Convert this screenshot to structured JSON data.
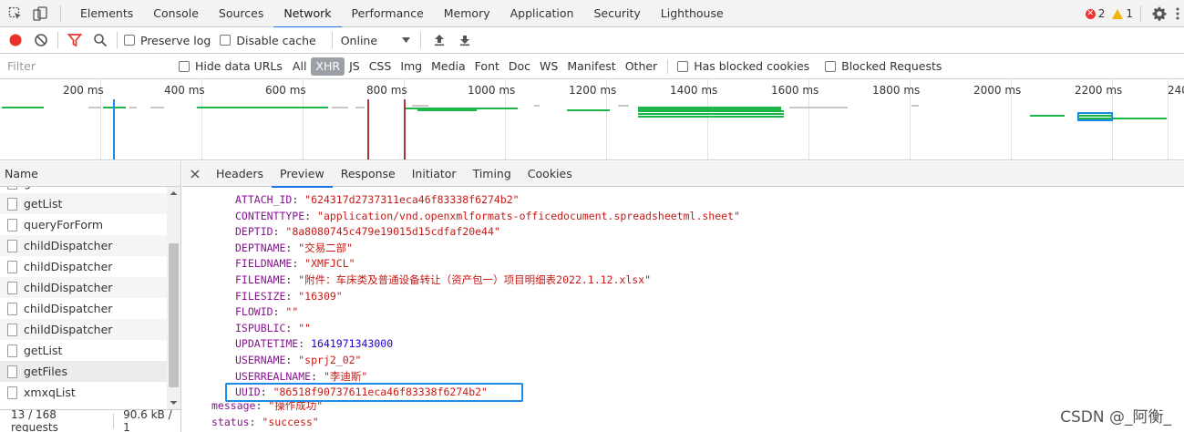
{
  "topbar": {
    "tabs": [
      "Elements",
      "Console",
      "Sources",
      "Network",
      "Performance",
      "Memory",
      "Application",
      "Security",
      "Lighthouse"
    ],
    "active_tab": "Network",
    "errors": "2",
    "warnings": "1",
    "icons": [
      "inspect-icon",
      "device-toggle-icon",
      "more-vertical-icon",
      "gear-icon"
    ]
  },
  "toolbar": {
    "preserve_log": "Preserve log",
    "disable_cache": "Disable cache",
    "throttle": "Online",
    "record_color": "#e8322b",
    "filter_color": "#e8322b"
  },
  "filterbar": {
    "filter_placeholder": "Filter",
    "hide_data_urls": "Hide data URLs",
    "types": [
      "All",
      "XHR",
      "JS",
      "CSS",
      "Img",
      "Media",
      "Font",
      "Doc",
      "WS",
      "Manifest",
      "Other"
    ],
    "selected_type": "XHR",
    "has_blocked": "Has blocked cookies",
    "blocked_requests": "Blocked Requests"
  },
  "timeline": {
    "ticks": [
      "200 ms",
      "400 ms",
      "600 ms",
      "800 ms",
      "1000 ms",
      "1200 ms",
      "1400 ms",
      "1600 ms",
      "1800 ms",
      "2000 ms",
      "2200 ms",
      "240"
    ]
  },
  "requests": {
    "header": "Name",
    "items": [
      "getList",
      "getList",
      "queryForForm",
      "childDispatcher",
      "childDispatcher",
      "childDispatcher",
      "childDispatcher",
      "childDispatcher",
      "getList",
      "getFiles",
      "xmxqList"
    ],
    "selected": "getFiles"
  },
  "status": {
    "requests": "13 / 168 requests",
    "transferred": "90.6 kB / 1"
  },
  "panel": {
    "tabs": [
      "Headers",
      "Preview",
      "Response",
      "Initiator",
      "Timing",
      "Cookies"
    ],
    "active_tab": "Preview"
  },
  "preview": {
    "fields": [
      {
        "key": "ATTACH_ID",
        "value": "\"624317d2737311eca46f83338f6274b2\"",
        "kind": "s"
      },
      {
        "key": "CONTENTTYPE",
        "value": "\"application/vnd.openxmlformats-officedocument.spreadsheetml.sheet\"",
        "kind": "s"
      },
      {
        "key": "DEPTID",
        "value": "\"8a8080745c479e19015d15cdfaf20e44\"",
        "kind": "s"
      },
      {
        "key": "DEPTNAME",
        "value": "\"交易二部\"",
        "kind": "s"
      },
      {
        "key": "FIELDNAME",
        "value": "\"XMFJCL\"",
        "kind": "s"
      },
      {
        "key": "FILENAME",
        "value": "\"附件：车床类及普通设备转让（资产包一）项目明细表2022.1.12.xlsx\"",
        "kind": "s"
      },
      {
        "key": "FILESIZE",
        "value": "\"16309\"",
        "kind": "s"
      },
      {
        "key": "FLOWID",
        "value": "\"\"",
        "kind": "s"
      },
      {
        "key": "ISPUBLIC",
        "value": "\"\"",
        "kind": "s"
      },
      {
        "key": "UPDATETIME",
        "value": "1641971343000",
        "kind": "n"
      },
      {
        "key": "USERNAME",
        "value": "\"sprj2_02\"",
        "kind": "s"
      },
      {
        "key": "USERREALNAME",
        "value": "\"李迪斯\"",
        "kind": "s"
      },
      {
        "key": "UUID",
        "value": "\"86518f90737611eca46f83338f6274b2\"",
        "kind": "s"
      }
    ],
    "tail": [
      {
        "key": "message",
        "value": "\"操作成功\"",
        "kind": "s"
      },
      {
        "key": "status",
        "value": "\"success\"",
        "kind": "s"
      }
    ]
  },
  "watermark": "CSDN @_阿衡_"
}
